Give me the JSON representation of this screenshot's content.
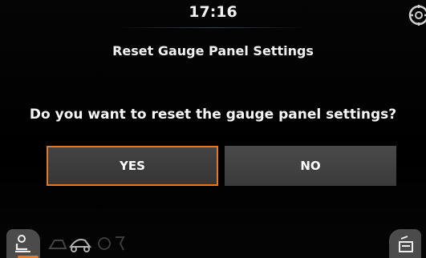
{
  "status_bar": {
    "time": "17:16",
    "corner_icon": "settings-gear-icon"
  },
  "dialog": {
    "title": "Reset Gauge Panel Settings",
    "question": "Do you want to reset the gauge panel settings?",
    "yes_label": "YES",
    "no_label": "NO",
    "selected": "YES"
  },
  "bottom_bar": {
    "left_tab_icon": "operator-seat-icon",
    "dim_icons": [
      "machine-icon",
      "vehicle-icon",
      "settings-icon"
    ],
    "right_tab_icon": "display-panel-icon"
  },
  "colors": {
    "accent": "#e07a2a",
    "button": "#3f3f3f",
    "background": "#000000"
  }
}
